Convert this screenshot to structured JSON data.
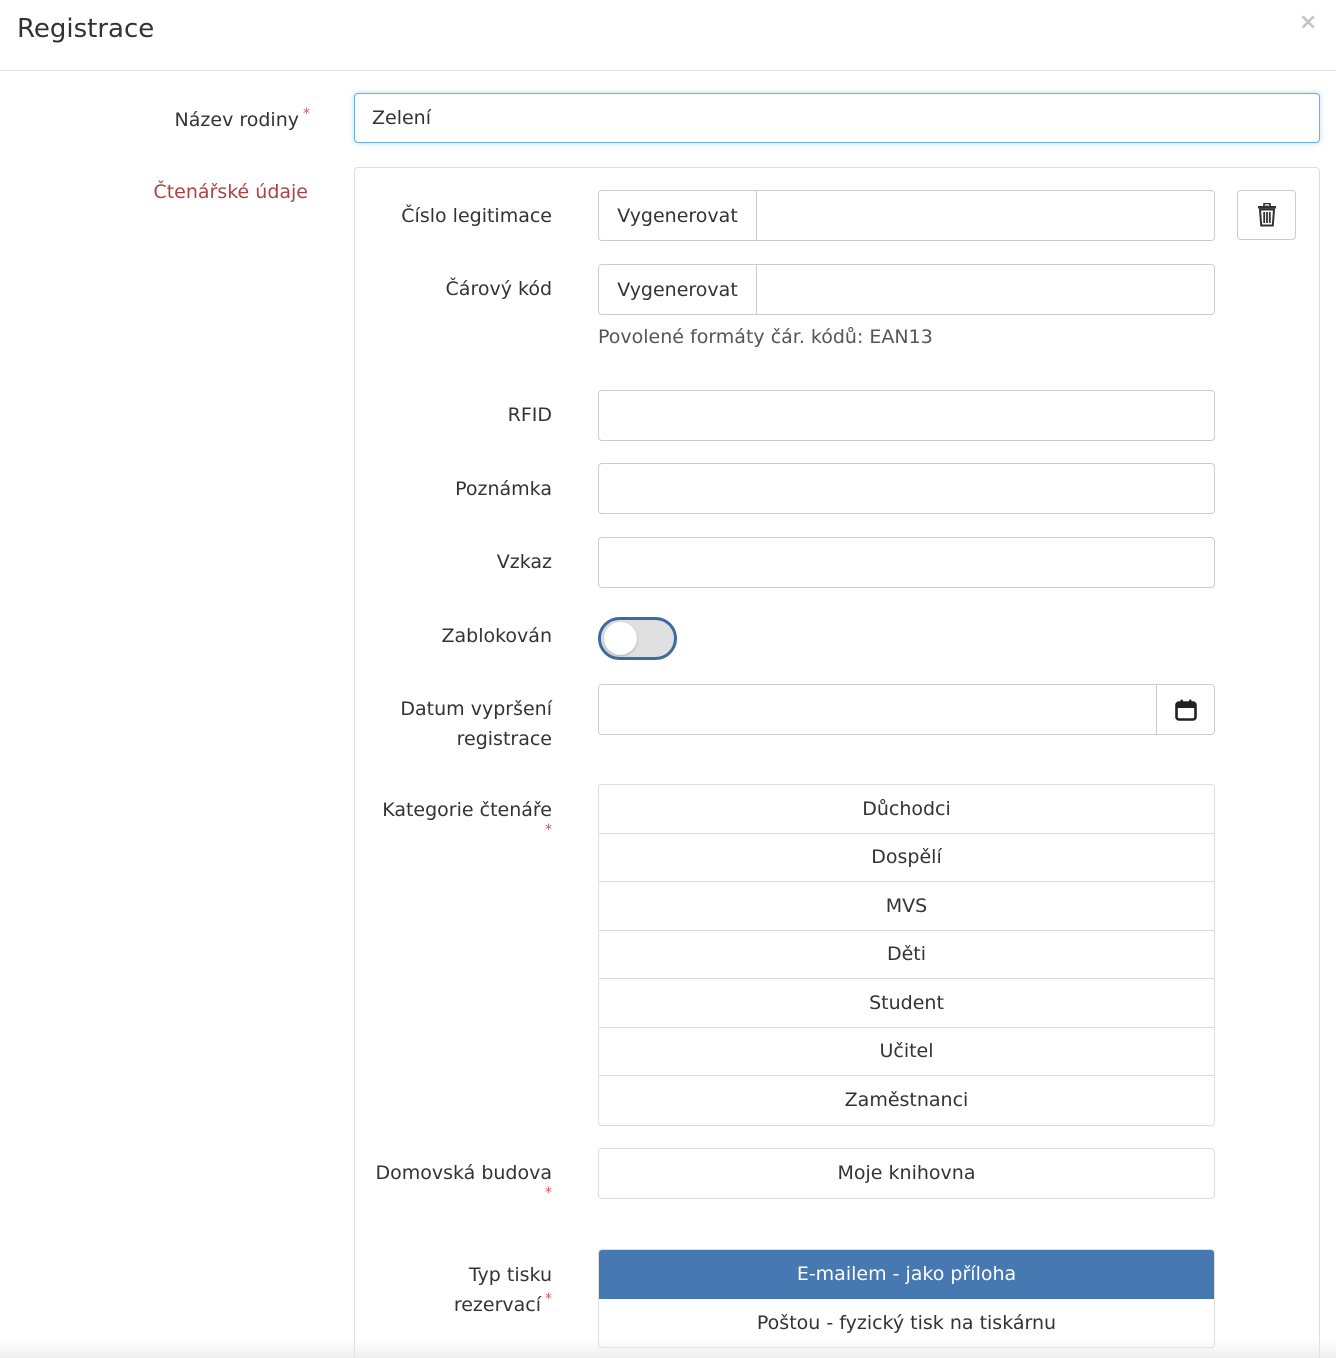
{
  "modal": {
    "title": "Registrace",
    "close_glyph": "×"
  },
  "family": {
    "label": "Název rodiny",
    "required_mark": "*",
    "value": "Zelení"
  },
  "section": {
    "label": "Čtenářské údaje"
  },
  "fields": {
    "card_number": {
      "label": "Číslo legitimace",
      "button": "Vygenerovat",
      "value": ""
    },
    "barcode": {
      "label": "Čárový kód",
      "button": "Vygenerovat",
      "value": "",
      "help": "Povolené formáty čár. kódů: EAN13"
    },
    "rfid": {
      "label": "RFID",
      "value": ""
    },
    "note": {
      "label": "Poznámka",
      "value": ""
    },
    "message": {
      "label": "Vzkaz",
      "value": ""
    },
    "blocked": {
      "label": "Zablokován",
      "on": false
    },
    "expiry": {
      "label_line1": "Datum vypršení",
      "label_line2": "registrace",
      "value": ""
    },
    "category": {
      "label": "Kategorie čtenáře",
      "required_mark": "*",
      "options": [
        "Důchodci",
        "Dospělí",
        "MVS",
        "Děti",
        "Student",
        "Učitel",
        "Zaměstnanci"
      ]
    },
    "building": {
      "label": "Domovská budova",
      "required_mark": "*",
      "options": [
        "Moje knihovna"
      ]
    },
    "print_type": {
      "label_line1": "Typ tisku",
      "label_line2": "rezervací",
      "required_mark": "*",
      "options": [
        "E-mailem - jako příloha",
        "Poštou - fyzický tisk na tiskárnu"
      ],
      "selected_index": 0
    }
  },
  "colors": {
    "accent": "#4678b2",
    "section_label": "#a94442",
    "required": "#d9534f",
    "focus_border": "#66afe9"
  }
}
